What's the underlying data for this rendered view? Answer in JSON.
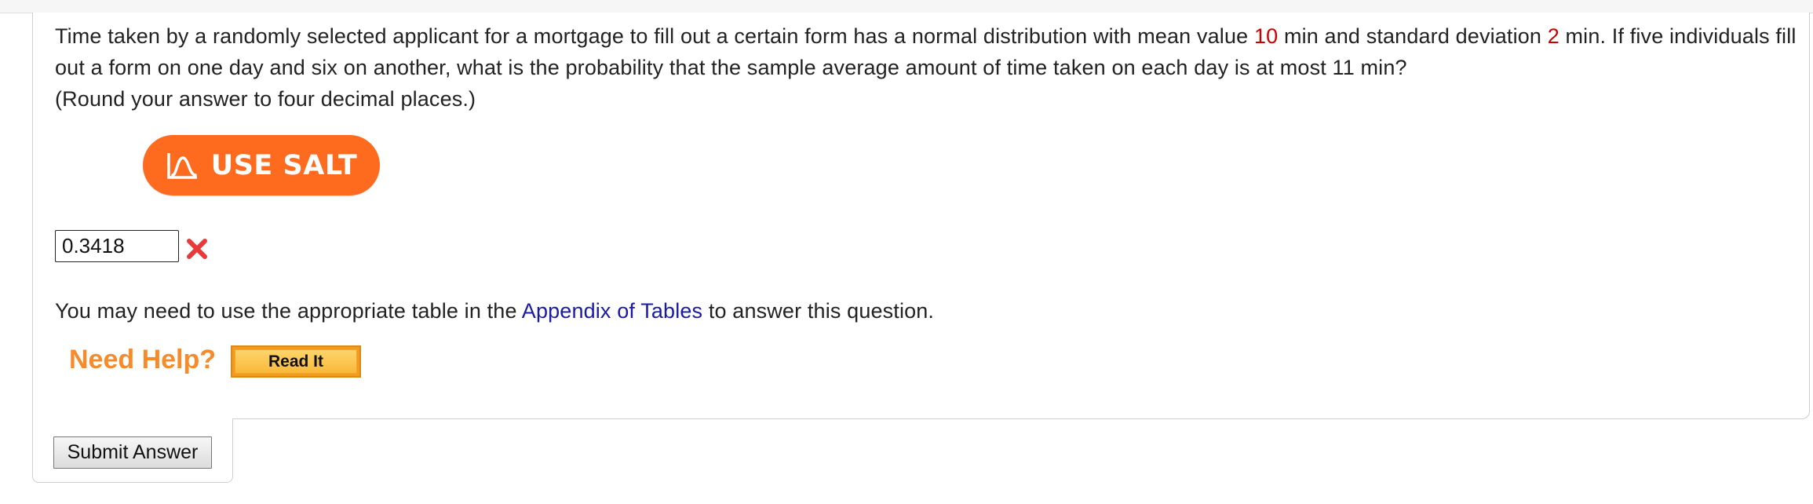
{
  "question": {
    "text_part1": "Time taken by a randomly selected applicant for a mortgage to fill out a certain form has a normal distribution with mean value ",
    "mean_value": "10",
    "text_part2": " min and standard deviation ",
    "std_value": "2",
    "text_part3": " min. If five individuals fill out a form on one day and six on another, what is the probability that the sample average amount of time taken on each day is at most 11 min?",
    "instruction": "(Round your answer to four decimal places.)"
  },
  "salt_button": {
    "label": "USE SALT",
    "icon": "salt-distribution-icon"
  },
  "answer": {
    "value": "0.3418",
    "status_icon": "wrong-x-icon"
  },
  "appendix": {
    "text_before": "You may need to use the appropriate table in the ",
    "link_text": "Appendix of Tables",
    "text_after": " to answer this question."
  },
  "help": {
    "label": "Need Help?",
    "read_it_label": "Read It"
  },
  "submit": {
    "label": "Submit Answer"
  },
  "colors": {
    "highlight_red": "#cc0000",
    "salt_orange": "#ff6b1e",
    "help_orange": "#f68b2c",
    "link_blue": "#1a1aa6",
    "wrong_red": "#e83a3a"
  }
}
